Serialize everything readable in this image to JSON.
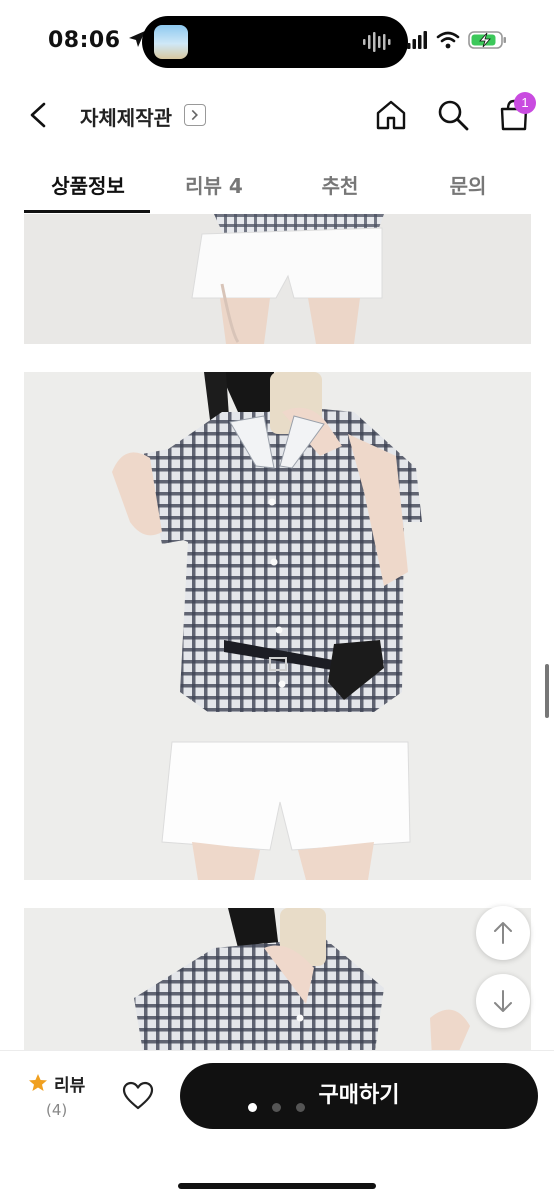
{
  "status_bar": {
    "time": "08:06",
    "icons": [
      "location-arrow-icon",
      "signal-icon",
      "wifi-icon",
      "battery-charging-icon"
    ]
  },
  "header": {
    "store_name": "자체제작관",
    "store_chevron": "›",
    "icons": [
      "back-icon",
      "home-icon",
      "search-icon",
      "cart-icon"
    ],
    "cart_badge": "1"
  },
  "tabs": [
    {
      "label": "상품정보",
      "active": true
    },
    {
      "label": "리뷰 4",
      "active": false
    },
    {
      "label": "추천",
      "active": false
    },
    {
      "label": "문의",
      "active": false
    }
  ],
  "scroll_buttons": {
    "up_icon": "arrow-up-icon",
    "down_icon": "arrow-down-icon"
  },
  "bottom_bar": {
    "review_label": "리뷰",
    "review_count": "(4)",
    "buy_label": "구매하기",
    "pager": {
      "total": 3,
      "current": 1
    }
  },
  "colors": {
    "accent_badge": "#c94be0",
    "star": "#f0a020",
    "buy_button": "#111111"
  }
}
